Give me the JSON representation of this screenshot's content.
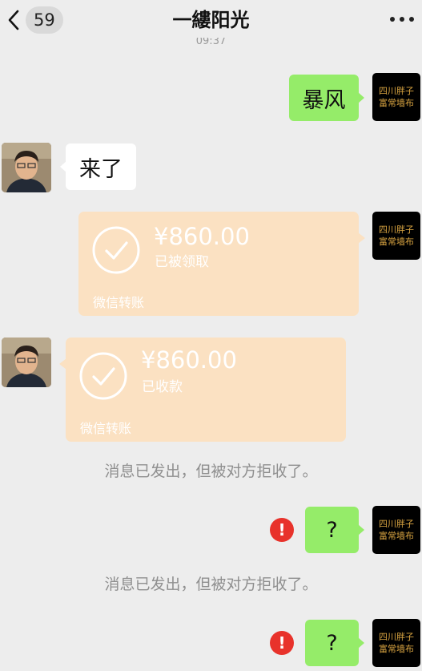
{
  "header": {
    "unread_count": "59",
    "title": "一縷阳光",
    "timestamp": "09:37"
  },
  "contact_avatar_text": {
    "line1": "四川胖子",
    "line2": "富常墙布"
  },
  "messages": {
    "m1": {
      "text": "暴风"
    },
    "m2": {
      "text": "来了"
    },
    "t1": {
      "amount": "¥860.00",
      "status": "已被领取",
      "brand": "微信转账"
    },
    "t2": {
      "amount": "¥860.00",
      "status": "已收款",
      "brand": "微信转账"
    },
    "sys1": {
      "text": "消息已发出，但被对方拒收了。"
    },
    "m3": {
      "text": "?"
    },
    "sys2": {
      "text": "消息已发出，但被对方拒收了。"
    },
    "m4": {
      "text": "?"
    }
  },
  "error_mark": "!",
  "colors": {
    "background": "#ededed",
    "sent_bubble": "#95ec69",
    "received_bubble": "#ffffff",
    "transfer_card": "#fbe1c2",
    "error_badge": "#e8322b",
    "avatar_text": "#d9a441"
  }
}
